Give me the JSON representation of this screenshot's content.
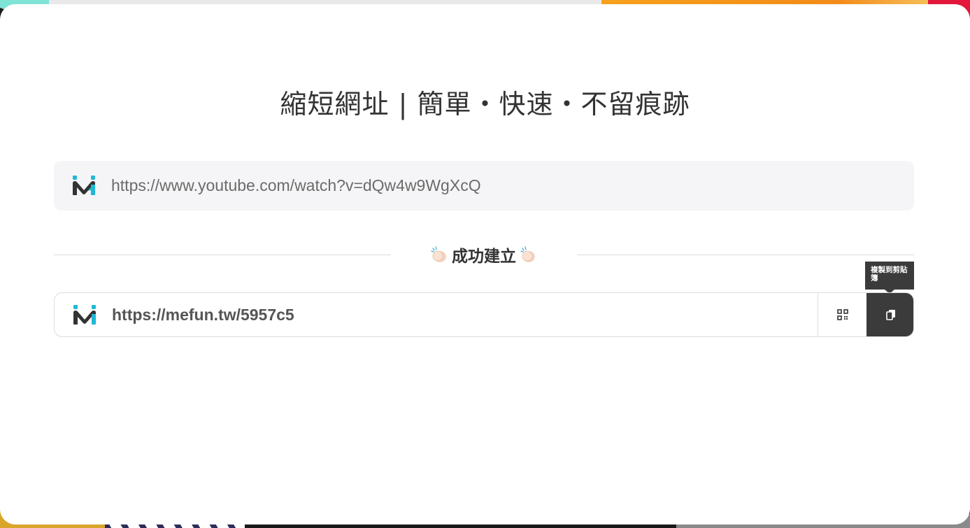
{
  "page": {
    "title": "縮短網址 | 簡單・快速・不留痕跡"
  },
  "url_input": {
    "value": "https://www.youtube.com/watch?v=dQw4w9WgXcQ",
    "icon": "mefun-logo-icon"
  },
  "result": {
    "status_label": "成功建立",
    "status_icon": "clapping-hands-icon",
    "short_url": "https://mefun.tw/5957c5",
    "logo_icon": "mefun-logo-icon",
    "qr_icon": "qr-code-icon",
    "copy_icon": "copy-icon",
    "copy_tooltip": "複製到剪貼簿"
  },
  "colors": {
    "accent_cyan": "#1fb8d6",
    "logo_dark": "#333333",
    "button_dark": "#3b3b3b",
    "input_bg": "#f5f5f7"
  }
}
